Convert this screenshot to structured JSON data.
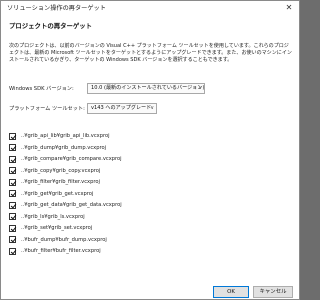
{
  "window": {
    "title": "ソリューション操作の再ターゲット",
    "close_glyph": "✕"
  },
  "heading": "プロジェクトの再ターゲット",
  "description": "次のプロジェクトは、以前のバージョンの Visual C++ プラットフォーム ツールセットを使用しています。これらのプロジェクトは、最新の Microsoft ツールセットをターゲットとするようにアップグレードできます。また、お使いのマシンにインストールされているかぎり、ターゲットの Windows SDK バージョンを選択することもできます。",
  "sdk": {
    "label": "Windows SDK バージョン:",
    "value": "10.0 (最新のインストールされているバージョン)",
    "chevron": "∨"
  },
  "toolset": {
    "label": "プラットフォーム ツールセット:",
    "value": "v143 へのアップグレード",
    "chevron": "∨"
  },
  "projects": [
    {
      "label": "..¥grib_api_lib¥grib_api_lib.vcxproj",
      "checked": true
    },
    {
      "label": "..¥grib_dump¥grib_dump.vcxproj",
      "checked": true
    },
    {
      "label": "..¥grib_compare¥grib_compare.vcxproj",
      "checked": true
    },
    {
      "label": "..¥grib_copy¥grib_copy.vcxproj",
      "checked": true
    },
    {
      "label": "..¥grib_filter¥grib_filter.vcxproj",
      "checked": true
    },
    {
      "label": "..¥grib_get¥grib_get.vcxproj",
      "checked": true
    },
    {
      "label": "..¥grib_get_data¥grib_get_data.vcxproj",
      "checked": true
    },
    {
      "label": "..¥grib_ls¥grib_ls.vcxproj",
      "checked": true
    },
    {
      "label": "..¥grib_set¥grib_set.vcxproj",
      "checked": true
    },
    {
      "label": "..¥bufr_dump¥bufr_dump.vcxproj",
      "checked": true
    },
    {
      "label": "..¥bufr_filter¥bufr_filter.vcxproj",
      "checked": true
    }
  ],
  "buttons": {
    "ok": "OK",
    "cancel": "キャンセル"
  }
}
